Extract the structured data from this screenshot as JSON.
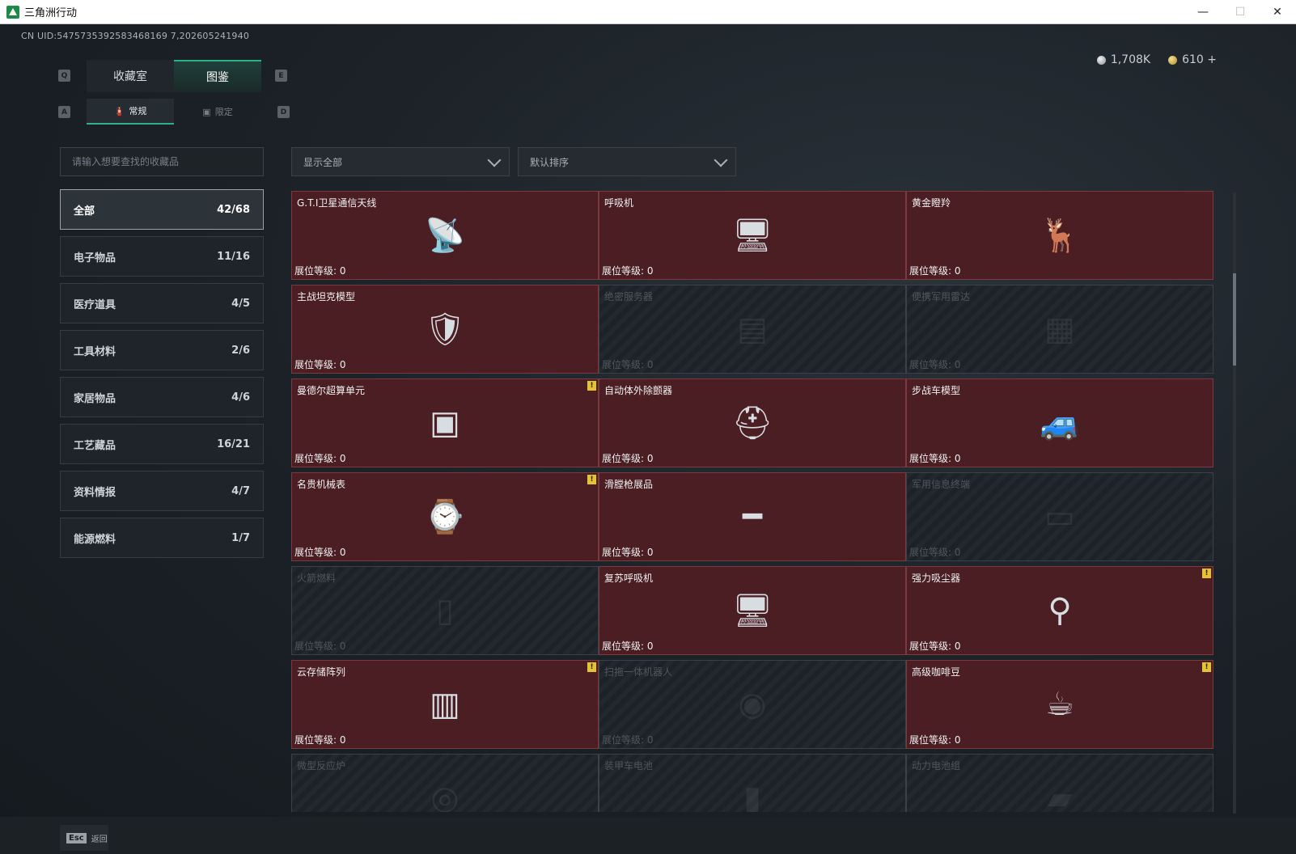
{
  "window": {
    "title": "三角洲行动",
    "controls": {
      "minimize": "—",
      "maximize": "☐",
      "close": "✕"
    }
  },
  "uid": "CN UID:5475735392583468169 7,202605241940",
  "currency": [
    {
      "icon": "silver-coin-icon",
      "value": "1,708K"
    },
    {
      "icon": "gold-coin-icon",
      "value": "610 +"
    }
  ],
  "key_hints": {
    "q": "Q",
    "e": "E",
    "a": "A",
    "d": "D"
  },
  "top_tabs": [
    {
      "label": "收藏室",
      "active": false
    },
    {
      "label": "图鉴",
      "active": true
    }
  ],
  "sub_tabs": [
    {
      "label": "常规",
      "icon": "fire-extinguisher-icon",
      "active": true
    },
    {
      "label": "限定",
      "icon": "picture-icon",
      "active": false
    }
  ],
  "search": {
    "placeholder": "请输入想要查找的收藏品"
  },
  "filters": {
    "show": "显示全部",
    "sort": "默认排序"
  },
  "categories": [
    {
      "label": "全部",
      "count": "42/68",
      "active": true
    },
    {
      "label": "电子物品",
      "count": "11/16",
      "active": false
    },
    {
      "label": "医疗道具",
      "count": "4/5",
      "active": false
    },
    {
      "label": "工具材料",
      "count": "2/6",
      "active": false
    },
    {
      "label": "家居物品",
      "count": "4/6",
      "active": false
    },
    {
      "label": "工艺藏品",
      "count": "16/21",
      "active": false
    },
    {
      "label": "资料情报",
      "count": "4/7",
      "active": false
    },
    {
      "label": "能源燃料",
      "count": "1/7",
      "active": false
    }
  ],
  "level_label": "展位等级: 0",
  "items": [
    {
      "name": "G.T.I卫星通信天线",
      "owned": true,
      "warn": false,
      "art": "satellite-dish-icon"
    },
    {
      "name": "呼吸机",
      "owned": true,
      "warn": false,
      "art": "ventilator-icon"
    },
    {
      "name": "黄金瞪羚",
      "owned": true,
      "warn": false,
      "art": "golden-gazelle-icon"
    },
    {
      "name": "主战坦克模型",
      "owned": true,
      "warn": false,
      "art": "tank-model-icon"
    },
    {
      "name": "绝密服务器",
      "owned": false,
      "warn": false,
      "art": "server-icon"
    },
    {
      "name": "便携军用雷达",
      "owned": false,
      "warn": false,
      "art": "radar-icon"
    },
    {
      "name": "曼德尔超算单元",
      "owned": true,
      "warn": true,
      "art": "supercompute-unit-icon"
    },
    {
      "name": "自动体外除颤器",
      "owned": true,
      "warn": false,
      "art": "defibrillator-icon"
    },
    {
      "name": "步战车模型",
      "owned": true,
      "warn": false,
      "art": "ifv-model-icon"
    },
    {
      "name": "名贵机械表",
      "owned": true,
      "warn": true,
      "art": "watch-icon"
    },
    {
      "name": "滑膛枪展品",
      "owned": true,
      "warn": false,
      "art": "musket-icon"
    },
    {
      "name": "军用信息终端",
      "owned": false,
      "warn": false,
      "art": "terminal-icon"
    },
    {
      "name": "火箭燃料",
      "owned": false,
      "warn": false,
      "art": "rocket-fuel-icon"
    },
    {
      "name": "复苏呼吸机",
      "owned": true,
      "warn": false,
      "art": "resuscitator-icon"
    },
    {
      "name": "强力吸尘器",
      "owned": true,
      "warn": true,
      "art": "vacuum-icon"
    },
    {
      "name": "云存储阵列",
      "owned": true,
      "warn": true,
      "art": "storage-array-icon"
    },
    {
      "name": "扫拖一体机器人",
      "owned": false,
      "warn": false,
      "art": "robot-vacuum-icon"
    },
    {
      "name": "高级咖啡豆",
      "owned": true,
      "warn": true,
      "art": "coffee-beans-icon"
    },
    {
      "name": "微型反应炉",
      "owned": false,
      "warn": false,
      "art": "reactor-icon"
    },
    {
      "name": "装甲车电池",
      "owned": false,
      "warn": false,
      "art": "battery-icon"
    },
    {
      "name": "动力电池组",
      "owned": false,
      "warn": false,
      "art": "battery-pack-icon"
    }
  ],
  "footer": {
    "esc_key": "Esc",
    "back": "返回"
  },
  "colors": {
    "accent": "#2fb08a",
    "owned_card": "#4a1e23",
    "warn": "#e5c233"
  }
}
